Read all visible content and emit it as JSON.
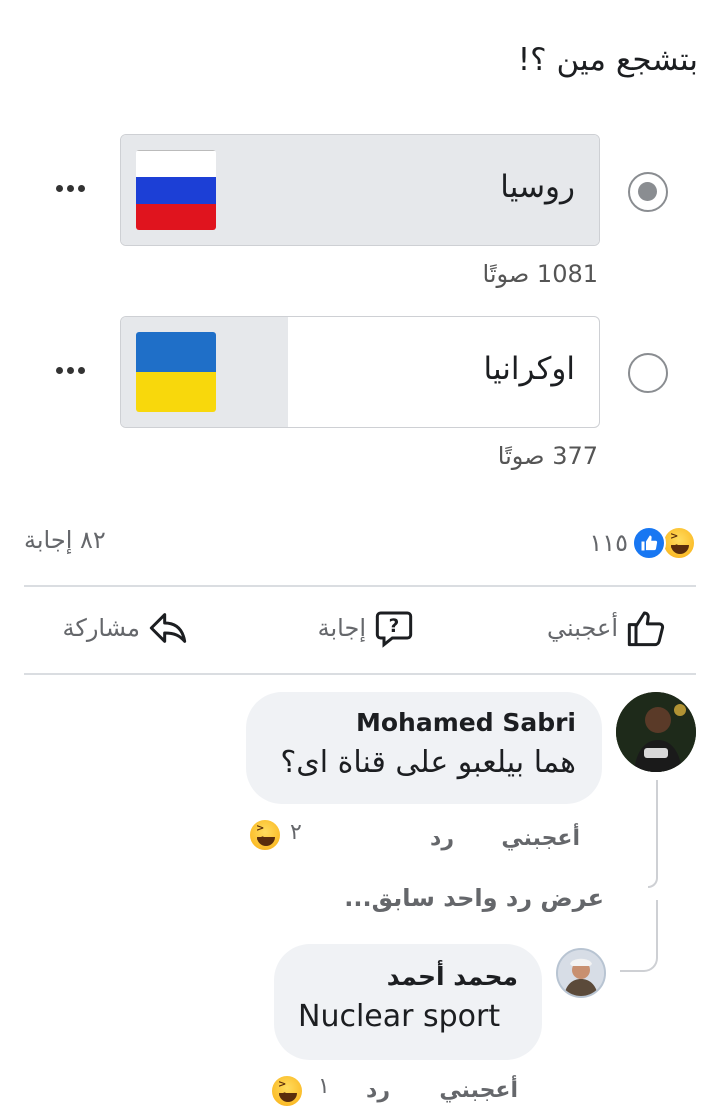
{
  "poll": {
    "question": "بتشجع مين ؟!",
    "options": [
      {
        "label": "روسيا",
        "votes_text": "1081 صوتًا",
        "selected": true,
        "fill_fraction": 1.0
      },
      {
        "label": "اوكرانيا",
        "votes_text": "377 صوتًا",
        "selected": false,
        "fill_fraction": 0.35
      }
    ]
  },
  "stats": {
    "reaction_count": "١١٥",
    "answers_count": "٨٢ إجابة"
  },
  "actions": {
    "like_label": "أعجبني",
    "answer_label": "إجابة",
    "share_label": "مشاركة"
  },
  "comments": [
    {
      "name": "Mohamed Sabri",
      "text": "هما بيلعبو على قناة اى؟",
      "like_label": "أعجبني",
      "reply_label": "رد",
      "reaction_count": "٢"
    }
  ],
  "view_previous_replies": "عرض رد واحد سابق...",
  "reply": {
    "name": "محمد أحمد",
    "text": "Nuclear sport",
    "like_label": "أعجبني",
    "reply_label": "رد",
    "reaction_count": "١"
  },
  "colors": {
    "russia_flag": [
      "#ffffff",
      "#1c3fd6",
      "#e0141e"
    ],
    "ukraine_flag": [
      "#1f6fc8",
      "#f8d80c"
    ],
    "like_blue": "#1877f2"
  }
}
